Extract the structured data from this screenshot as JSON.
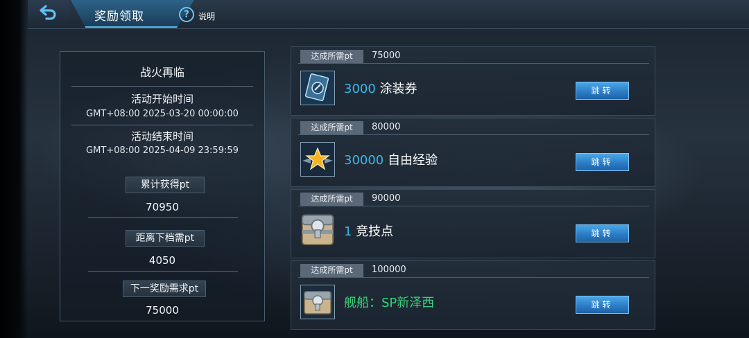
{
  "header": {
    "title": "奖励领取",
    "help_symbol": "?",
    "help_label": "说明"
  },
  "info": {
    "event_name": "战火再临",
    "start_label": "活动开始时间",
    "start_time": "GMT+08:00 2025-03-20 00:00:00",
    "end_label": "活动结束时间",
    "end_time": "GMT+08:00 2025-04-09 23:59:59",
    "total_label": "累计获得pt",
    "total_value": "70950",
    "next_gap_label": "距离下档需pt",
    "next_gap_value": "4050",
    "next_req_label": "下一奖励需求pt",
    "next_req_value": "75000"
  },
  "rewards": [
    {
      "req_label": "达成所需pt",
      "req_value": "75000",
      "qty": "3000",
      "name": " 涂装券",
      "button": "跳转",
      "icon": "skin-ticket-icon"
    },
    {
      "req_label": "达成所需pt",
      "req_value": "80000",
      "qty": "30000",
      "name": " 自由经验",
      "button": "跳转",
      "icon": "star-exp-icon"
    },
    {
      "req_label": "达成所需pt",
      "req_value": "90000",
      "qty": "1",
      "name": " 竞技点",
      "button": "跳转",
      "icon": "treasure-chest-icon"
    },
    {
      "req_label": "达成所需pt",
      "req_value": "100000",
      "ship_label": "舰船：SP新泽西",
      "button": "跳转",
      "icon": "ship-chest-icon"
    }
  ],
  "colors": {
    "accent_blue": "#3fb6e8",
    "ship_green": "#39d27a",
    "button_blue": "#2c7dc6"
  }
}
